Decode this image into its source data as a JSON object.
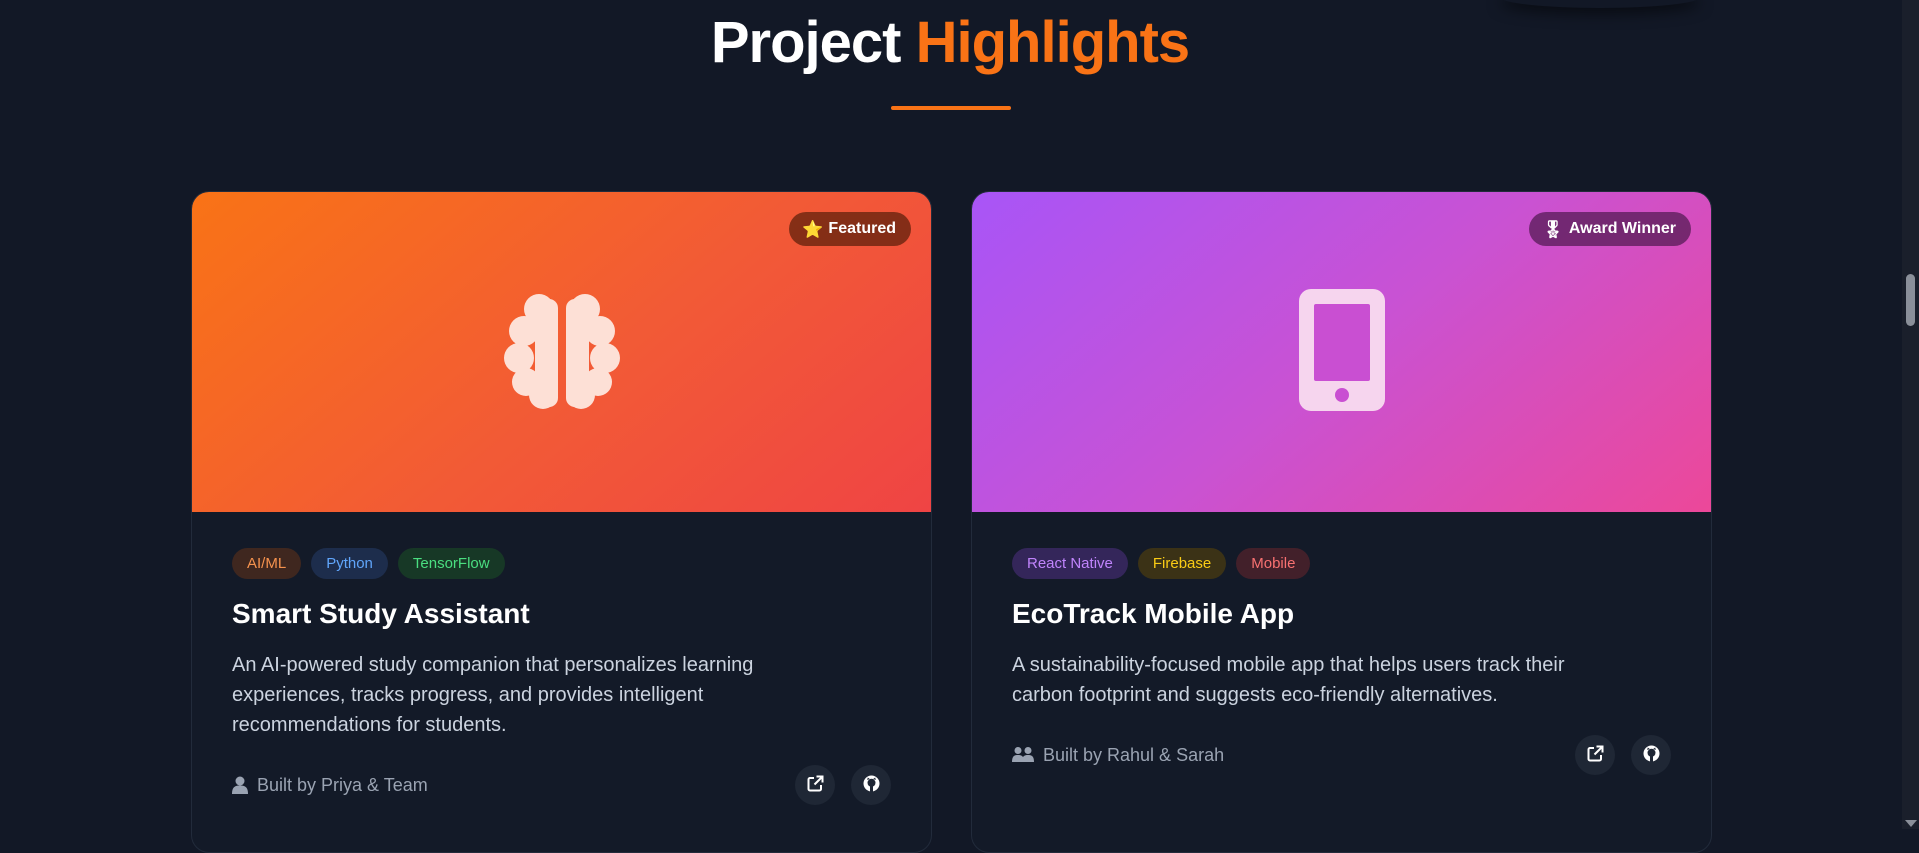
{
  "header": {
    "title_part1": "Project",
    "title_part2": "Highlights"
  },
  "projects": [
    {
      "badge_icon": "⭐",
      "badge_label": "Featured",
      "banner_icon": "brain-icon",
      "tags": [
        "AI/ML",
        "Python",
        "TensorFlow"
      ],
      "title": "Smart Study Assistant",
      "description": "An AI-powered study companion that personalizes learning experiences, tracks progress, and provides intelligent recommendations for students.",
      "builder": "Built by Priya & Team",
      "builder_icon": "user-icon"
    },
    {
      "badge_icon": "🎖",
      "badge_label": "Award Winner",
      "banner_icon": "mobile-phone-icon",
      "tags": [
        "React Native",
        "Firebase",
        "Mobile"
      ],
      "title": "EcoTrack Mobile App",
      "description": "A sustainability-focused mobile app that helps users track their carbon footprint and suggests eco-friendly alternatives.",
      "builder": "Built by Rahul & Sarah",
      "builder_icon": "users-icon"
    }
  ],
  "colors": {
    "accent": "#f97316",
    "background": "#121826",
    "card1_gradient": [
      "#f97316",
      "#ef4444"
    ],
    "card2_gradient": [
      "#a855f7",
      "#ec4899"
    ]
  }
}
